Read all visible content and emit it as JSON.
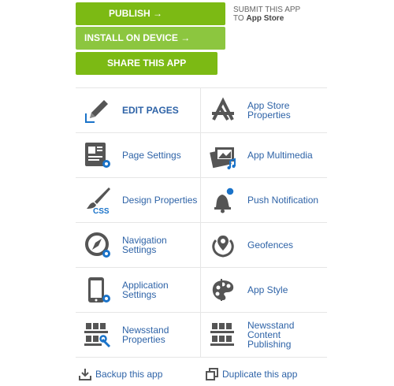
{
  "buttons": {
    "publish": "PUBLISH →",
    "install": "INSTALL ON DEVICE →",
    "share": "SHARE THIS APP"
  },
  "submit_note": {
    "line1": "SUBMIT THIS APP",
    "line2_prefix": "TO ",
    "line2_store": "App Store"
  },
  "grid": {
    "edit_pages": "EDIT PAGES",
    "app_store_properties": "App Store Properties",
    "page_settings": "Page Settings",
    "app_multimedia": "App Multimedia",
    "design_properties": "Design Properties",
    "push_notification": "Push Notification",
    "navigation_settings": "Navigation Settings",
    "geofences": "Geofences",
    "application_settings": "Application Settings",
    "app_style": "App Style",
    "newsstand_properties": "Newsstand Properties",
    "newsstand_content_publishing": "Newsstand Content Publishing"
  },
  "footer": {
    "backup": "Backup this app",
    "duplicate": "Duplicate this app"
  },
  "colors": {
    "primary_green": "#7cba14",
    "install_green": "#8cc63f",
    "link_blue": "#2e63a7",
    "icon_gray": "#555555",
    "accent_blue": "#1a73c9"
  }
}
